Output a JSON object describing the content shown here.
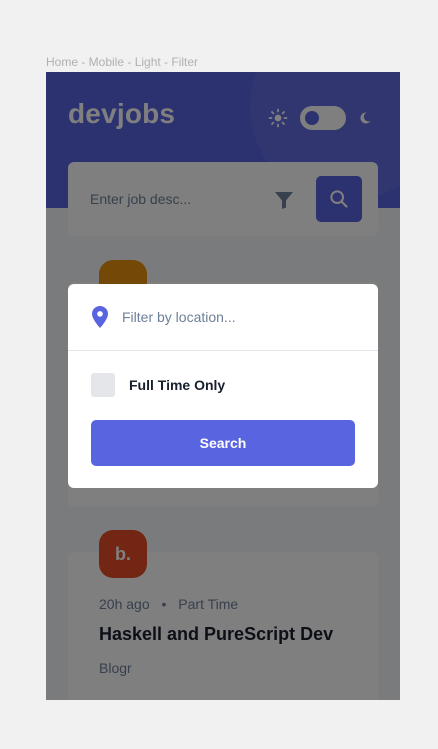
{
  "frame": {
    "label": "Home - Mobile - Light - Filter"
  },
  "header": {
    "logo": "devjobs",
    "theme": {
      "mode": "light"
    }
  },
  "search": {
    "placeholder": "Enter job desc...",
    "value": "",
    "filter_icon": "filter-icon",
    "search_icon": "search-icon"
  },
  "jobs": [
    {
      "badge_text": "",
      "badge_color": "#e99210",
      "posted": "",
      "type": "",
      "title": "",
      "company": ""
    },
    {
      "badge_text": "b.",
      "badge_color": "#e54d26",
      "posted": "20h ago",
      "separator": "•",
      "type": "Part Time",
      "title": "Haskell and PureScript Dev",
      "company": "Blogr"
    }
  ],
  "filter_modal": {
    "location_placeholder": "Filter by location...",
    "location_value": "",
    "location_icon": "location-pin-icon",
    "full_time_label": "Full Time Only",
    "full_time_checked": false,
    "search_label": "Search"
  },
  "colors": {
    "accent": "#5964e0",
    "text_dark": "#19202d",
    "text_gray": "#6e8098",
    "background": "#f4f6f8"
  }
}
